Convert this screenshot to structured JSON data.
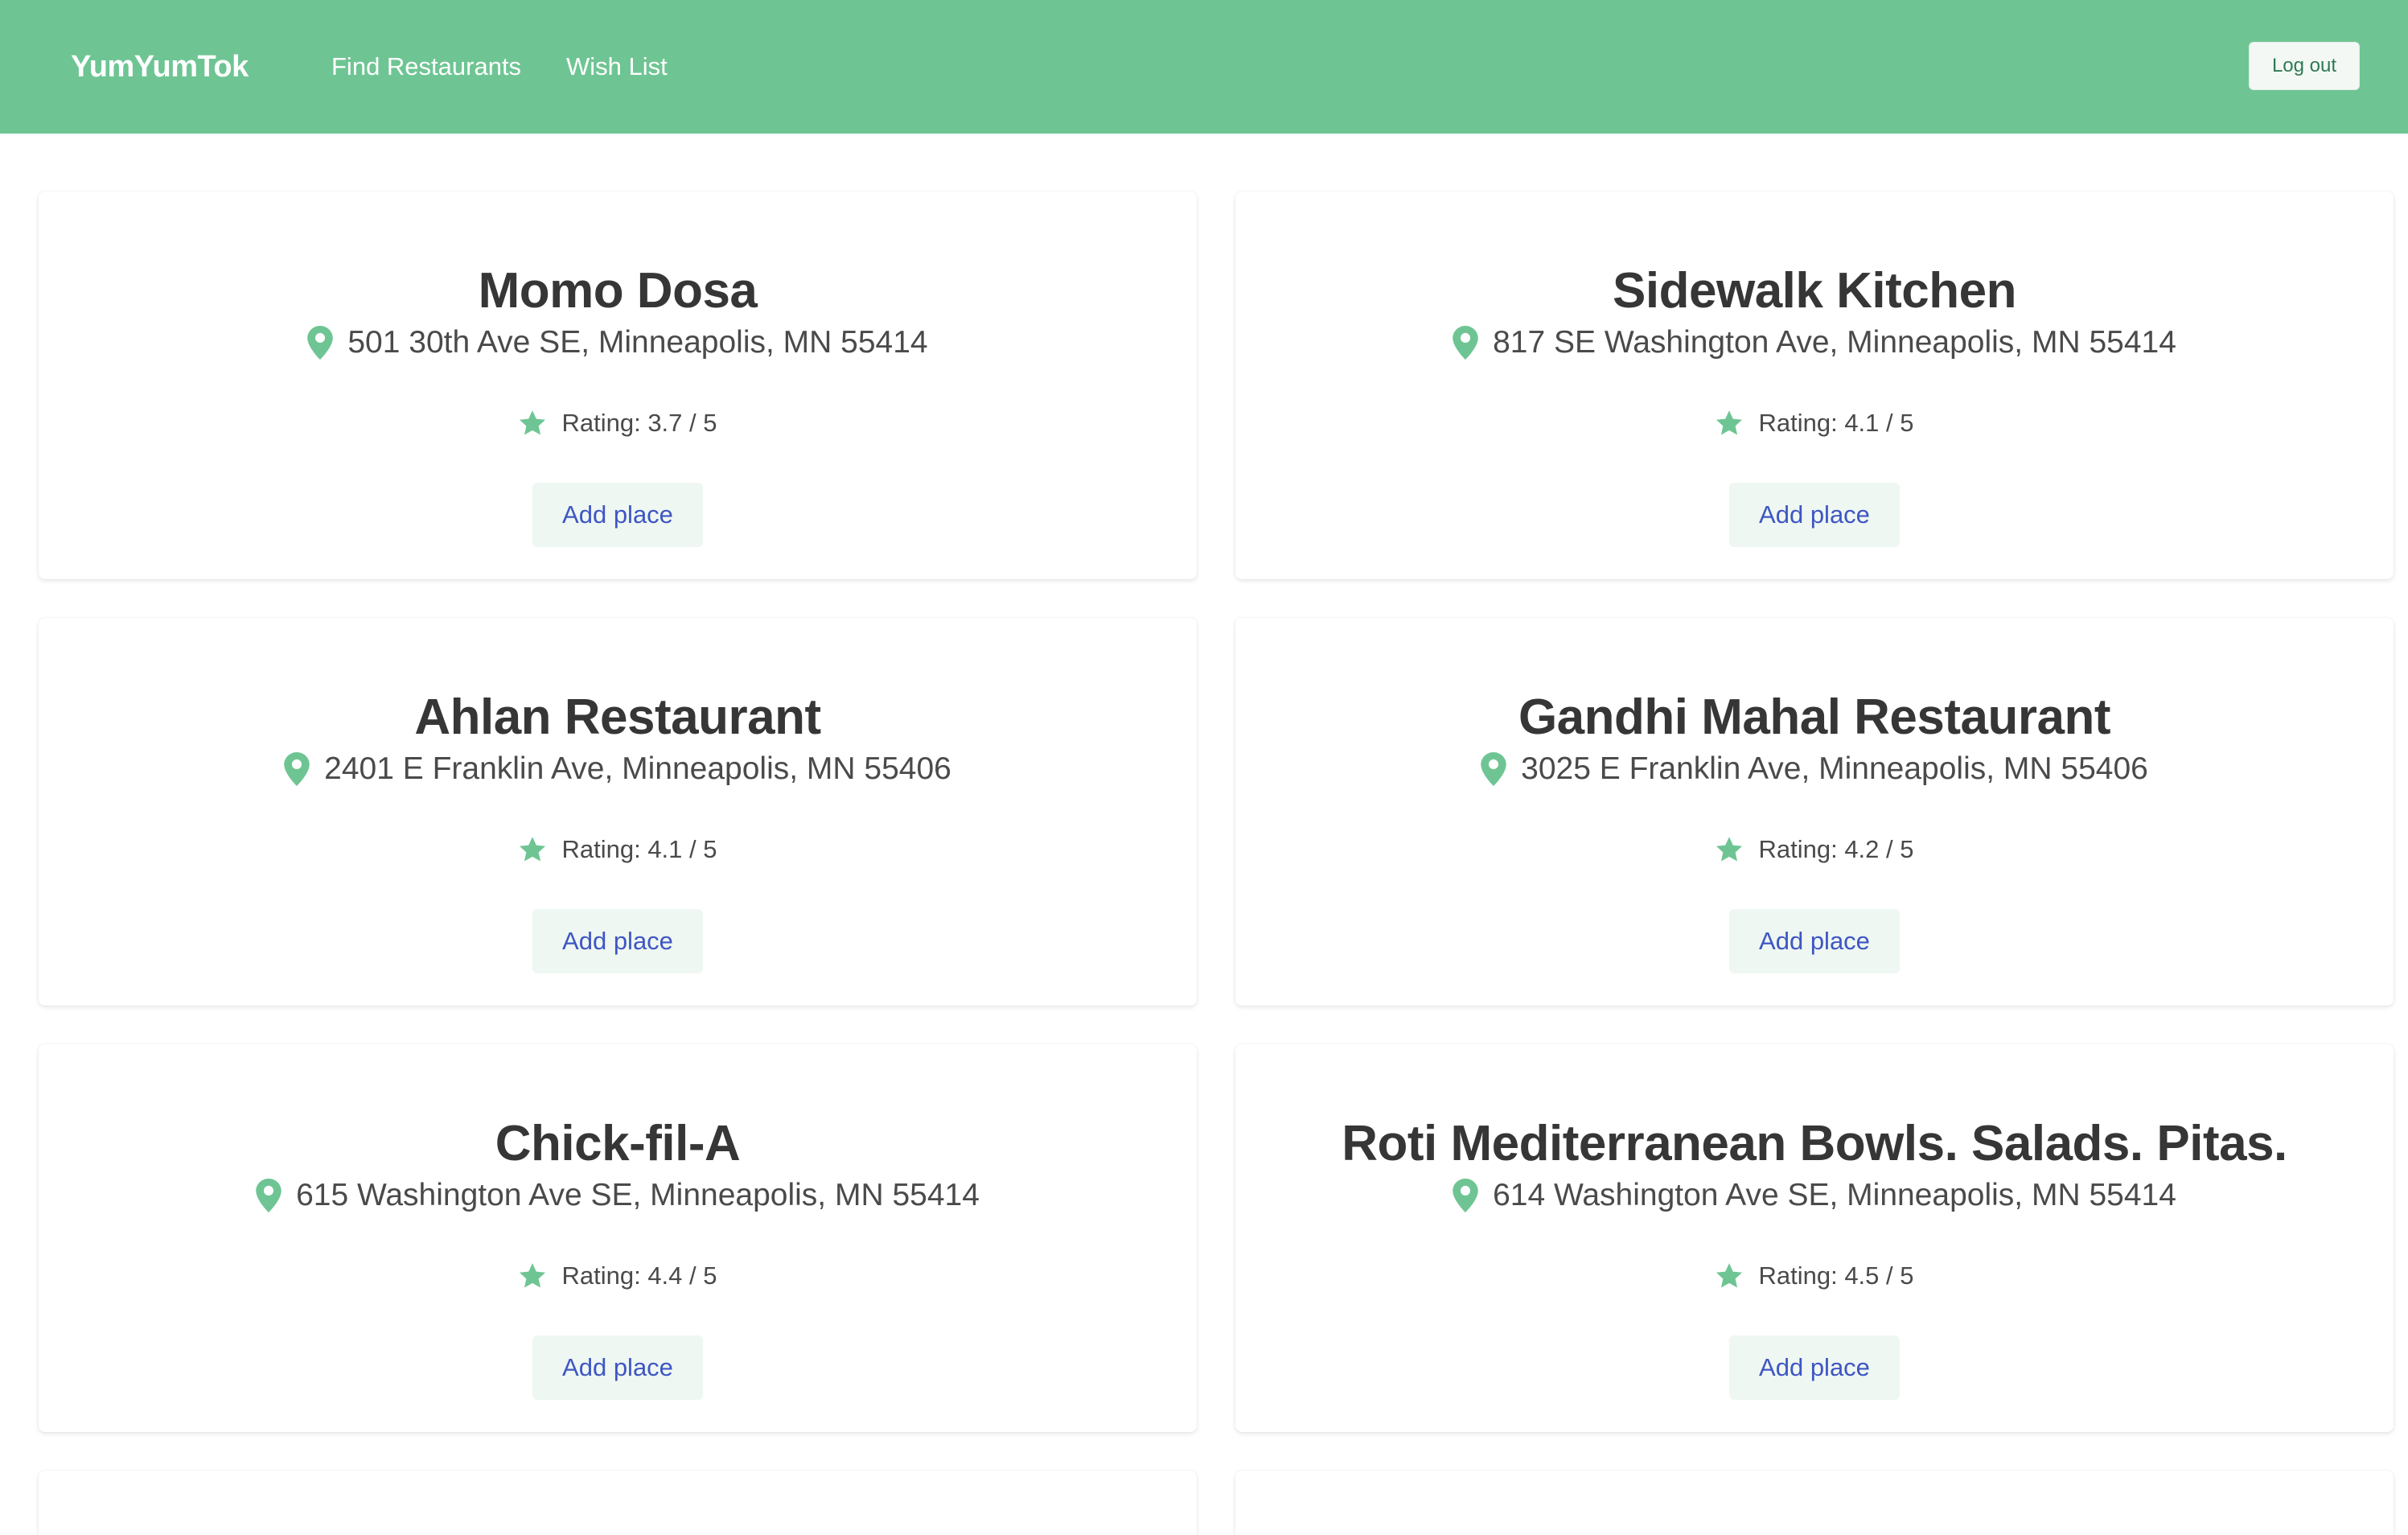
{
  "navbar": {
    "brand": "YumYumTok",
    "links": [
      "Find Restaurants",
      "Wish List"
    ],
    "logout_label": "Log out",
    "bg_color": "#6ec593"
  },
  "colors": {
    "accent": "#6ec593",
    "button_text": "#3e56c4",
    "button_bg": "#eff7f2"
  },
  "icons": {
    "location": "map-pin-icon",
    "rating": "star-icon"
  },
  "restaurants": [
    {
      "name": "Momo Dosa",
      "address": "501 30th Ave SE, Minneapolis, MN 55414",
      "rating_text": "Rating: 3.7 / 5",
      "rating": 3.7,
      "button_label": "Add place"
    },
    {
      "name": "Sidewalk Kitchen",
      "address": "817 SE Washington Ave, Minneapolis, MN 55414",
      "rating_text": "Rating: 4.1 / 5",
      "rating": 4.1,
      "button_label": "Add place"
    },
    {
      "name": "Ahlan Restaurant",
      "address": "2401 E Franklin Ave, Minneapolis, MN 55406",
      "rating_text": "Rating: 4.1 / 5",
      "rating": 4.1,
      "button_label": "Add place"
    },
    {
      "name": "Gandhi Mahal Restaurant",
      "address": "3025 E Franklin Ave, Minneapolis, MN 55406",
      "rating_text": "Rating: 4.2 / 5",
      "rating": 4.2,
      "button_label": "Add place"
    },
    {
      "name": "Chick-fil-A",
      "address": "615 Washington Ave SE, Minneapolis, MN 55414",
      "rating_text": "Rating: 4.4 / 5",
      "rating": 4.4,
      "button_label": "Add place"
    },
    {
      "name": "Roti Mediterranean Bowls. Salads. Pitas.",
      "address": "614 Washington Ave SE, Minneapolis, MN 55414",
      "rating_text": "Rating: 4.5 / 5",
      "rating": 4.5,
      "button_label": "Add place"
    }
  ]
}
